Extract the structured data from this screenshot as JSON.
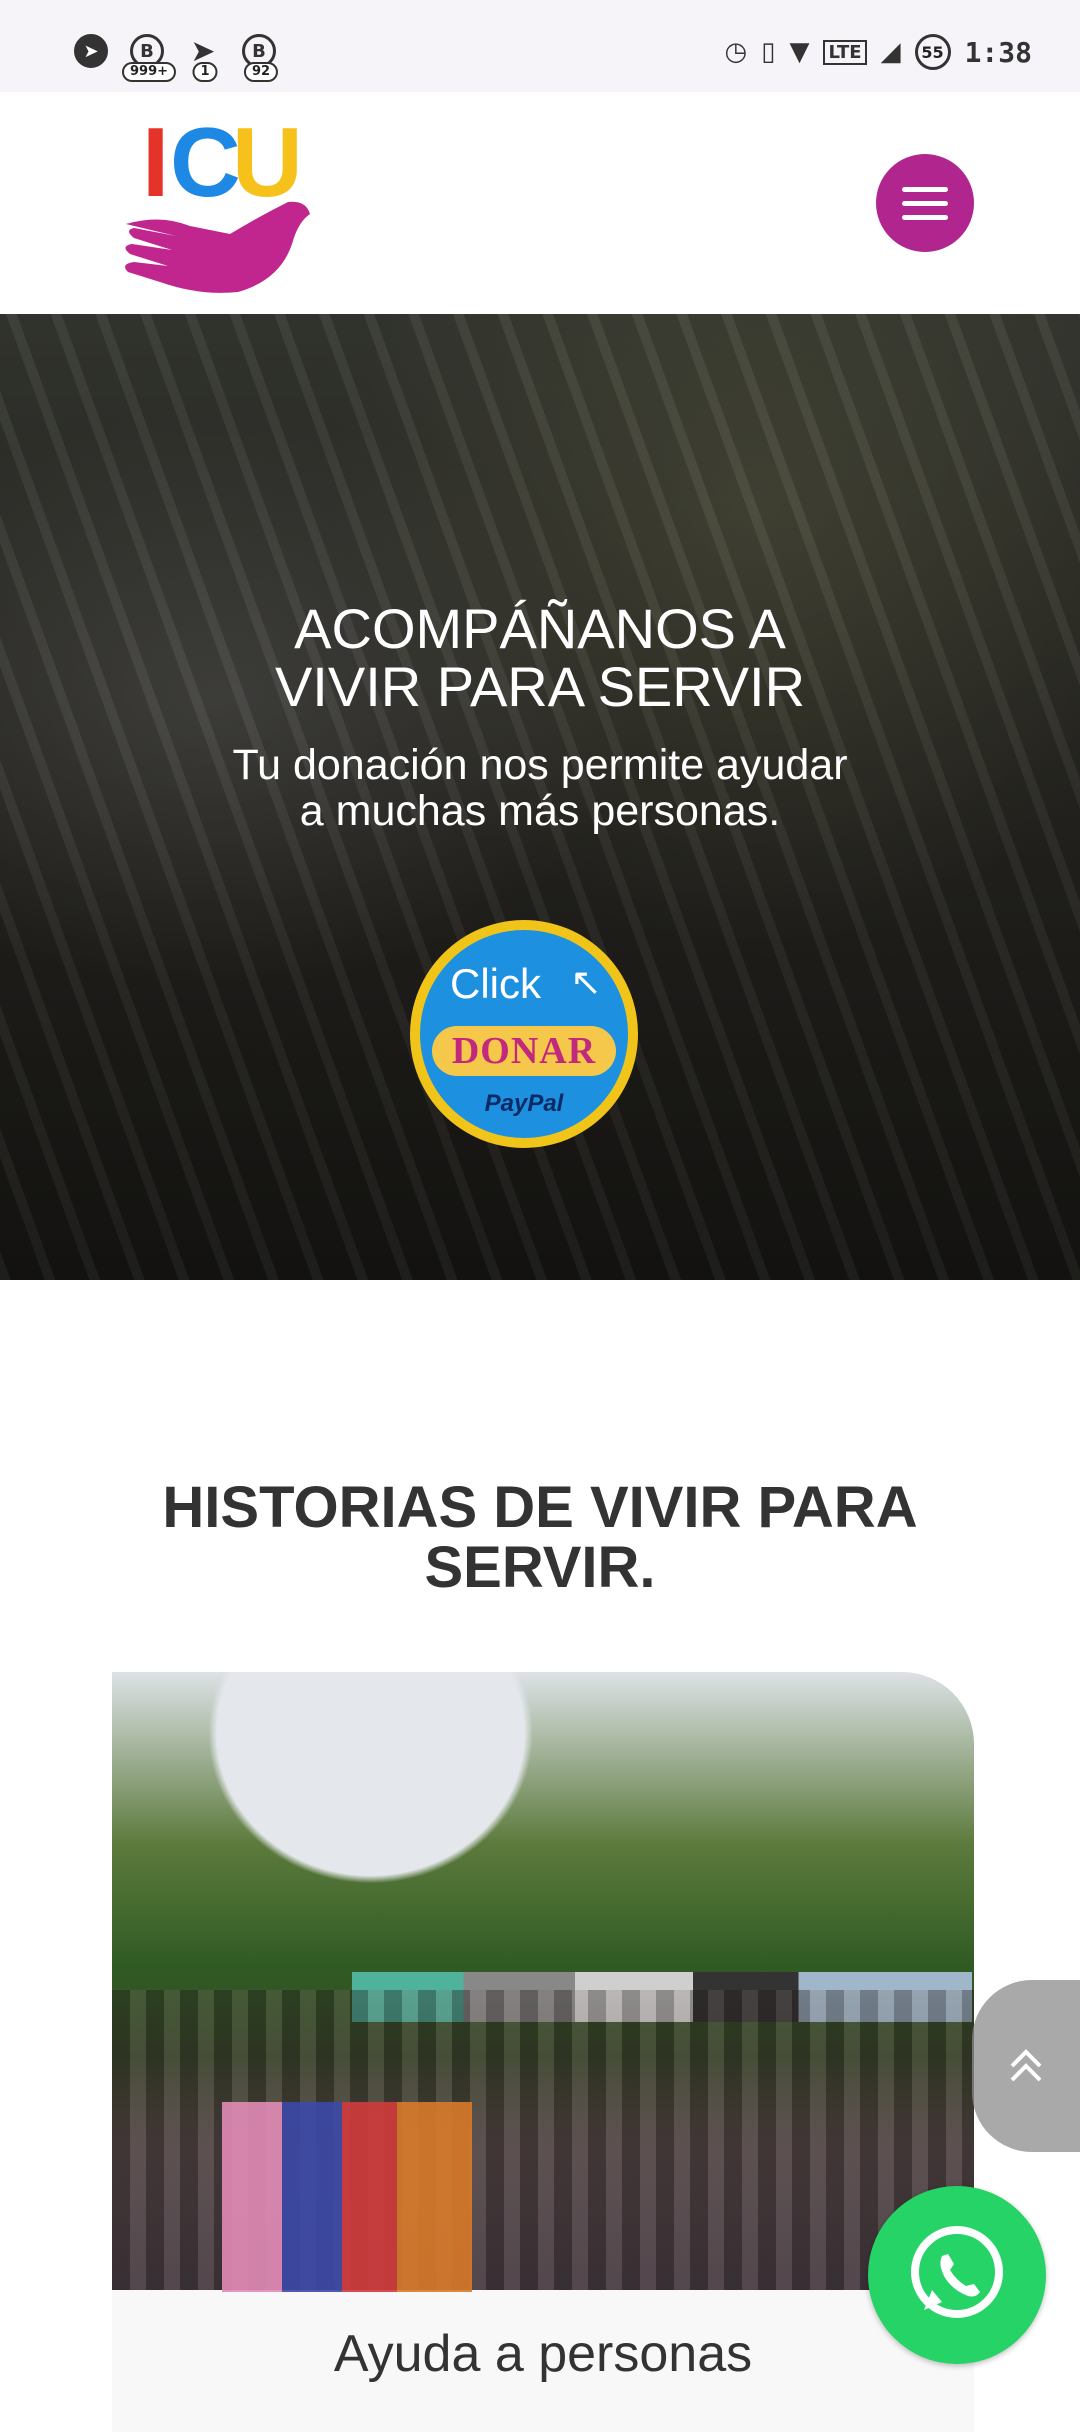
{
  "status_bar": {
    "left_icons": [
      {
        "icon": "telegram-icon",
        "badge": ""
      },
      {
        "icon": "b-app-icon",
        "badge": "999+"
      },
      {
        "icon": "telegram-icon",
        "badge": "1"
      },
      {
        "icon": "b-app-icon",
        "badge": "92"
      }
    ],
    "right_icons": [
      "alarm-icon",
      "vibrate-icon",
      "wifi-icon",
      "volte-icon",
      "signal-icon"
    ],
    "battery": "55",
    "time": "1:38"
  },
  "header": {
    "logo_text": "ICU",
    "logo_colors": [
      "#e6332a",
      "#1e88e5",
      "#f6c11b",
      "#c1268f"
    ],
    "menu_color": "#b1268e"
  },
  "hero": {
    "title": "ACOMPÁÑANOS A\nVIVIR PARA SERVIR",
    "subtitle": "Tu donación nos permite ayudar\na muchas más personas.",
    "donate": {
      "click": "Click",
      "label": "DONAR",
      "provider": "PayPal"
    }
  },
  "stories": {
    "title": "HISTORIAS DE VIVIR PARA\nSERVIR.",
    "cards": [
      {
        "title": "Ayuda a personas"
      }
    ]
  },
  "floating": {
    "scroll_top_icon": "double-chevron-up-icon",
    "whatsapp_icon": "whatsapp-icon",
    "whatsapp_color": "#25d366"
  }
}
